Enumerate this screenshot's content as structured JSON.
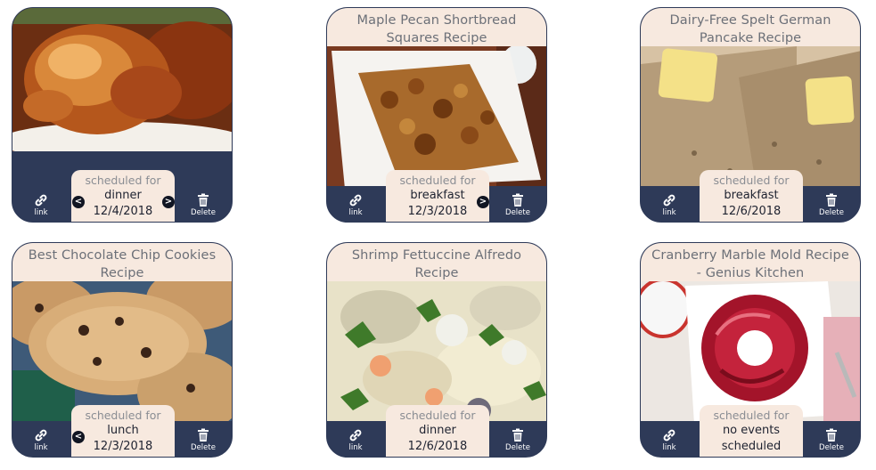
{
  "cards": [
    {
      "title": "",
      "scheduled_label": "scheduled for",
      "meal": "dinner",
      "date": "12/4/2018",
      "link_label": "link",
      "delete_label": "Delete",
      "prev_arrow": "<",
      "next_arrow": ">"
    },
    {
      "title": "Maple Pecan Shortbread Squares Recipe",
      "scheduled_label": "scheduled for",
      "meal": "breakfast",
      "date": "12/3/2018",
      "link_label": "link",
      "delete_label": "Delete",
      "next_arrow": ">"
    },
    {
      "title": "Dairy-Free Spelt German Pancake Recipe",
      "scheduled_label": "scheduled for",
      "meal": "breakfast",
      "date": "12/6/2018",
      "link_label": "link",
      "delete_label": "Delete"
    },
    {
      "title": "Best Chocolate Chip Cookies Recipe",
      "scheduled_label": "scheduled for",
      "meal": "lunch",
      "date": "12/3/2018",
      "link_label": "link",
      "delete_label": "Delete",
      "prev_arrow": "<"
    },
    {
      "title": "Shrimp Fettuccine Alfredo Recipe",
      "scheduled_label": "scheduled for",
      "meal": "dinner",
      "date": "12/6/2018",
      "link_label": "link",
      "delete_label": "Delete"
    },
    {
      "title": "Cranberry Marble Mold Recipe - Genius Kitchen",
      "scheduled_label": "scheduled for",
      "meal": "no events",
      "date": "scheduled",
      "link_label": "link",
      "delete_label": "Delete"
    }
  ],
  "icons": {
    "link": "link-icon",
    "delete": "trash-icon"
  },
  "colors": {
    "card_bar": "#2e3a58",
    "card_title_bg": "#f7e9df",
    "arrow_bg": "#111522"
  }
}
